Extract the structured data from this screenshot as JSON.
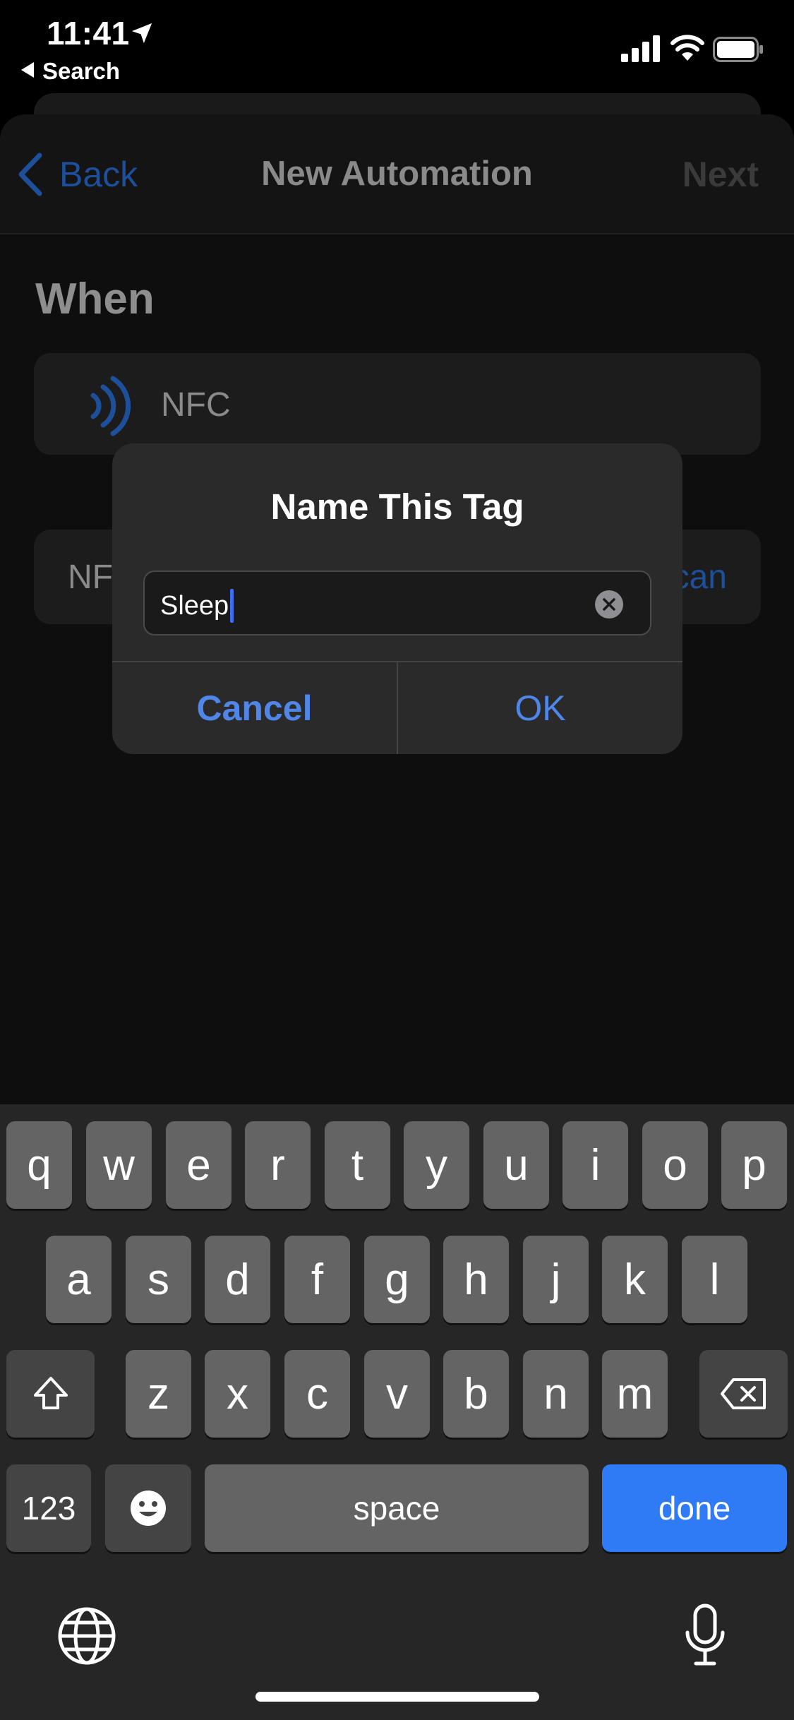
{
  "status_bar": {
    "time": "11:41",
    "back_app_label": "Search"
  },
  "navbar": {
    "back_label": "Back",
    "title": "New Automation",
    "next_label": "Next"
  },
  "content": {
    "section_label": "When",
    "nfc_label": "NFC",
    "tag_row_label": "NF",
    "tag_row_action": "can"
  },
  "alert": {
    "title": "Name This Tag",
    "input_value": "Sleep",
    "cancel_label": "Cancel",
    "ok_label": "OK"
  },
  "keyboard": {
    "row1": [
      "q",
      "w",
      "e",
      "r",
      "t",
      "y",
      "u",
      "i",
      "o",
      "p"
    ],
    "row2": [
      "a",
      "s",
      "d",
      "f",
      "g",
      "h",
      "j",
      "k",
      "l"
    ],
    "row3": [
      "z",
      "x",
      "c",
      "v",
      "b",
      "n",
      "m"
    ],
    "numbers_label": "123",
    "space_label": "space",
    "done_label": "done"
  },
  "colors": {
    "accent": "#4f86e8",
    "done_key": "#2f7bf6",
    "key": "#646464",
    "key_dark": "#444444"
  }
}
